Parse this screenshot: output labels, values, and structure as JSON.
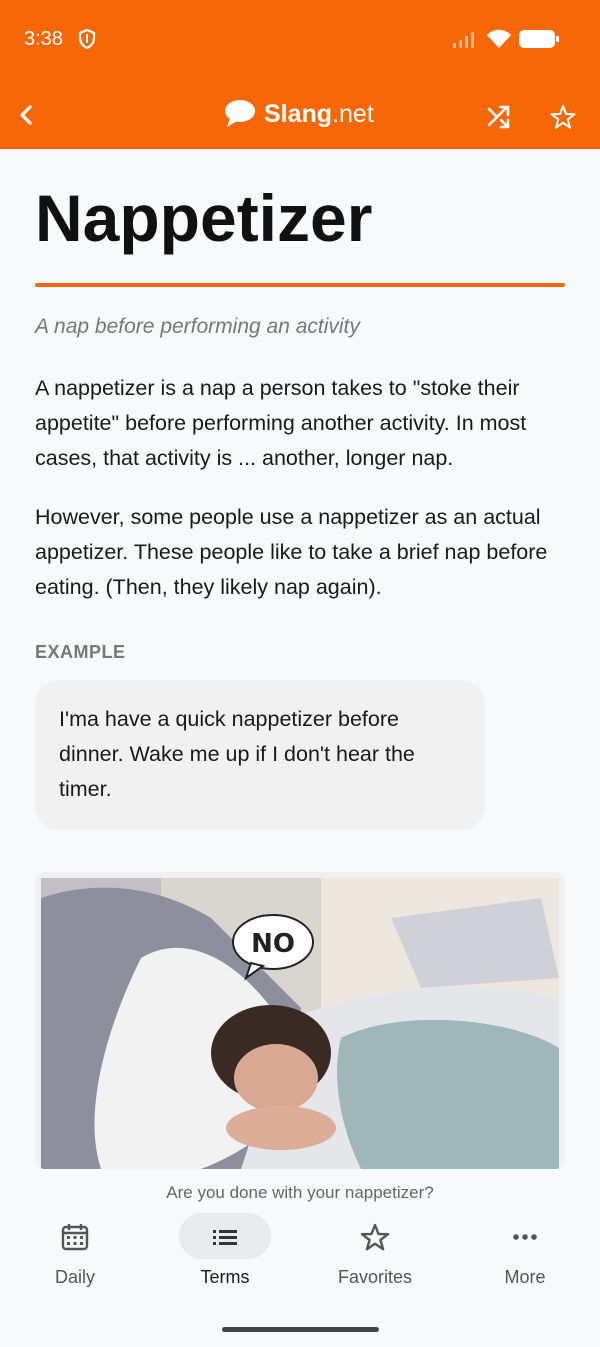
{
  "status_bar": {
    "time": "3:38"
  },
  "header": {
    "brand_bold": "Slang",
    "brand_light": ".net"
  },
  "term": {
    "title": "Nappetizer",
    "subtitle": "A nap before performing an activity",
    "paragraphs": [
      "A nappetizer is a nap a person takes to \"stoke their appetite\" before performing another activity. In most cases, that activity is ... another, longer nap.",
      "However, some people use a nappetizer as an actual appetizer. These people like to take a brief nap before eating. (Then, they likely nap again)."
    ],
    "example_label": "EXAMPLE",
    "example_text": "I'ma have a quick nappetizer before dinner. Wake me up if I don't hear the timer.",
    "image_speech": "NO",
    "caption": "Are you done with your nappetizer?"
  },
  "bottom_nav": {
    "items": [
      {
        "label": "Daily",
        "icon": "calendar-icon"
      },
      {
        "label": "Terms",
        "icon": "list-icon"
      },
      {
        "label": "Favorites",
        "icon": "star-icon"
      },
      {
        "label": "More",
        "icon": "more-icon"
      }
    ],
    "active": "Terms"
  },
  "colors": {
    "accent": "#f76707",
    "background": "#f8f9fa"
  }
}
